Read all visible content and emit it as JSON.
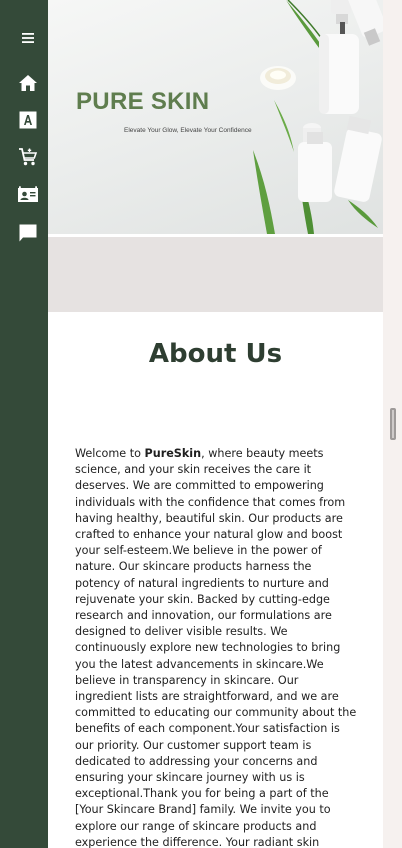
{
  "sidebar": {
    "items": [
      {
        "icon": "menu-icon"
      },
      {
        "icon": "home-icon"
      },
      {
        "icon": "letter-a-icon"
      },
      {
        "icon": "cart-icon"
      },
      {
        "icon": "contact-card-icon"
      },
      {
        "icon": "chat-icon"
      }
    ]
  },
  "hero": {
    "title": "PURE SKIN",
    "tagline": "Elevate Your Glow, Elevate Your Confidence"
  },
  "about": {
    "heading": "About Us",
    "intro_prefix": "Welcome to ",
    "brand": "PureSkin",
    "body": ", where beauty meets science, and your skin receives the care it deserves. We are committed to empowering individuals with the confidence that comes from having healthy, beautiful skin. Our products are crafted to enhance your natural glow and boost your self-esteem.We believe in the power of nature. Our skincare products harness the potency of natural ingredients to nurture and rejuvenate your skin. Backed by cutting-edge research and innovation, our formulations are designed to deliver visible results. We continuously explore new technologies to bring you the latest advancements in skincare.We believe in transparency in skincare. Our ingredient lists are straightforward, and we are committed to educating our community about the benefits of each component.Your satisfaction is our priority. Our customer support team is dedicated to addressing your concerns and ensuring your skincare journey with us is exceptional.Thank you for being a part of the [Your Skincare Brand] family. We invite you to explore our range of skincare products and experience the difference. Your radiant skin journey begins here."
  },
  "colors": {
    "sidebar": "#344a39",
    "brand_green": "#5f7d4e",
    "heading": "#2e3e31",
    "band": "#e6e2e1"
  }
}
